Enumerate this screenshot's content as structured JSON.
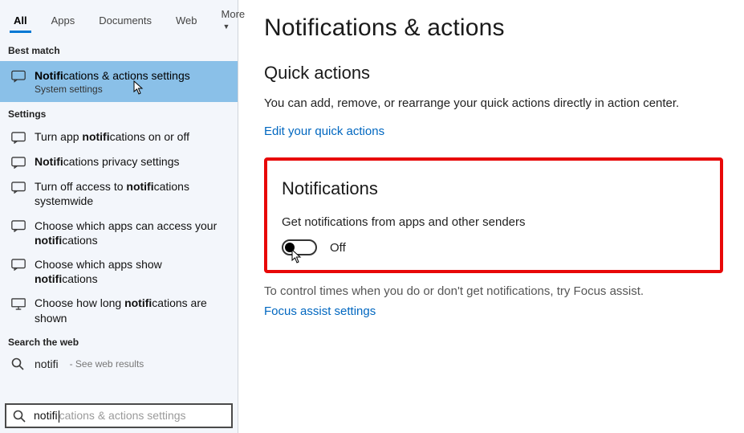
{
  "tabs": {
    "all": "All",
    "apps": "Apps",
    "documents": "Documents",
    "web": "Web",
    "more": "More"
  },
  "groups": {
    "bestMatch": "Best match",
    "settings": "Settings",
    "searchWeb": "Search the web"
  },
  "bestMatch": {
    "pre": "Notifi",
    "bold": "cations & actions settings",
    "sub": "System settings"
  },
  "settingsResults": [
    {
      "pre": "Turn app ",
      "bold": "notifi",
      "post": "cations on or off"
    },
    {
      "pre": "",
      "bold": "Notifi",
      "post": "cations privacy settings"
    },
    {
      "pre": "Turn off access to ",
      "bold": "notifi",
      "post": "cations systemwide"
    },
    {
      "pre": "Choose which apps can access your ",
      "bold": "notifi",
      "post": "cations"
    },
    {
      "pre": "Choose which apps show ",
      "bold": "notifi",
      "post": "cations"
    },
    {
      "pre": "Choose how long ",
      "bold": "notifi",
      "post": "cations are shown"
    }
  ],
  "webResult": {
    "term": "notifi",
    "hint": "- See web results"
  },
  "searchBox": {
    "typed": "notifi",
    "ghost": "cations & actions settings"
  },
  "content": {
    "pageTitle": "Notifications & actions",
    "quickActionsHeading": "Quick actions",
    "quickActionsBody": "You can add, remove, or rearrange your quick actions directly in action center.",
    "editLink": "Edit your quick actions",
    "notificationsHeading": "Notifications",
    "toggleCaption": "Get notifications from apps and other senders",
    "toggleState": "Off",
    "focusBody": "To control times when you do or don't get notifications, try Focus assist.",
    "focusLink": "Focus assist settings"
  }
}
